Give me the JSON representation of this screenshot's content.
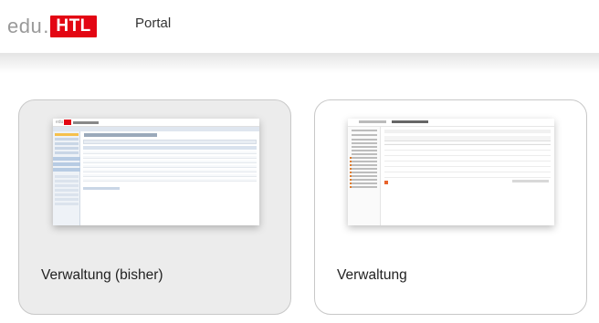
{
  "header": {
    "logo": {
      "edu": "edu",
      "dot": ".",
      "htl": "HTL",
      "brand_color": "#e30613"
    },
    "nav": {
      "portal_label": "Portal"
    }
  },
  "cards": [
    {
      "title": "Verwaltung (bisher)",
      "background": "#ececec",
      "thumbnail": "legacy-admin-screenshot"
    },
    {
      "title": "Verwaltung",
      "background": "#ffffff",
      "thumbnail": "new-admin-screenshot"
    }
  ]
}
